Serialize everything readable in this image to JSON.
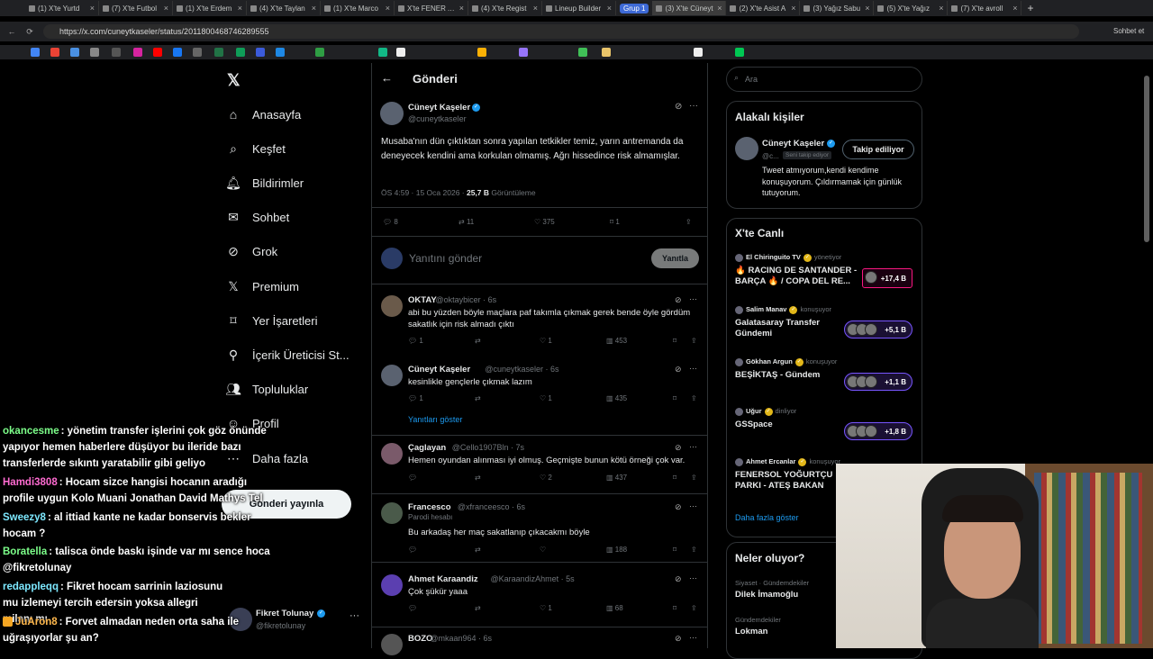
{
  "browser": {
    "tabs": [
      {
        "label": "(1) X'te Yurtd"
      },
      {
        "label": "(7) X'te Futbol"
      },
      {
        "label": "(1) X'te Erdem"
      },
      {
        "label": "(4) X'te Taylan"
      },
      {
        "label": "(1) X'te Marco"
      },
      {
        "label": "X'te FENER AĞ"
      },
      {
        "label": "(4) X'te Regist"
      },
      {
        "label": "Lineup Builder"
      },
      {
        "label": "(3) X'te Cüneyt"
      },
      {
        "label": "(2) X'te Asist A"
      },
      {
        "label": "(3) Yağız Sabu"
      },
      {
        "label": "(5) X'te Yağız"
      },
      {
        "label": "(7) X'te avroll"
      }
    ],
    "group_label": "Grup 1",
    "url": "https://x.com/cuneytkaseler/status/2011800468746289555",
    "chat_button": "Sohbet et"
  },
  "sidebar": {
    "items": [
      {
        "label": "Anasayfa",
        "icon": "home-icon"
      },
      {
        "label": "Keşfet",
        "icon": "search-icon"
      },
      {
        "label": "Bildirimler",
        "icon": "bell-icon"
      },
      {
        "label": "Sohbet",
        "icon": "mail-icon"
      },
      {
        "label": "Grok",
        "icon": "grok-icon"
      },
      {
        "label": "Premium",
        "icon": "x-icon"
      },
      {
        "label": "Yer İşaretleri",
        "icon": "bookmark-icon"
      },
      {
        "label": "İçerik Üreticisi St...",
        "icon": "creator-icon"
      },
      {
        "label": "Topluluklar",
        "icon": "people-icon"
      },
      {
        "label": "Profil",
        "icon": "user-icon"
      },
      {
        "label": "Daha fazla",
        "icon": "more-icon"
      }
    ],
    "post_button": "Gönderi yayınla",
    "account": {
      "name": "Fikret Tolunay",
      "handle": "@fikretolunay"
    }
  },
  "header": {
    "title": "Gönderi"
  },
  "main_post": {
    "name": "Cüneyt Kaşeler",
    "handle": "@cuneytkaseler",
    "text": "Musaba'nın dün çıktıktan sonra yapılan tetkikler temiz, yarın antremanda da deneyecek kendini ama korkulan olmamış. Ağrı hissedince risk almamışlar.",
    "time": "ÖS 4:59 · 15 Oca 2026 ·",
    "views": "25,7 B",
    "views_label": "Görüntüleme",
    "replies": "8",
    "reposts": "11",
    "likes": "375",
    "bookmarks": "1"
  },
  "reply_box": {
    "placeholder": "Yanıtını gönder",
    "button": "Yanıtla"
  },
  "replies": [
    {
      "name": "OKTAY",
      "handle": "@oktaybicer · 6s",
      "text": "abi bu yüzden böyle maçlara paf takımla çıkmak gerek bende öyle gördüm sakatlık için risk almadı çıktı",
      "reply": "1",
      "like": "1",
      "views": "453"
    },
    {
      "name": "Cüneyt Kaşeler",
      "handle": "@cuneytkaseler · 6s",
      "text": "kesinlikle gençlerle çıkmak lazım",
      "reply": "1",
      "like": "1",
      "views": "435"
    },
    {
      "name": "Çaglayan",
      "handle": "@Cello1907Bln · 7s",
      "text": "Hemen oyundan alınması iyi olmuş. Geçmişte bunun kötü örneği çok var.",
      "reply": "",
      "like": "2",
      "views": "437"
    },
    {
      "name": "Francesco",
      "handle": "@xfranceesco · 6s",
      "text": "Bu arkadaş her maç sakatlanıp çıkacakmı böyle",
      "reply": "",
      "like": "",
      "views": "188",
      "parody": "Parodi hesabı"
    },
    {
      "name": "Ahmet Karaandiz",
      "handle": "@KaraandizAhmet · 5s",
      "text": "Çok şükür yaaa",
      "reply": "",
      "like": "1",
      "views": "68"
    },
    {
      "name": "BOZO",
      "handle": "@mkaan964 · 6s"
    }
  ],
  "show_replies": "Yanıtları göster",
  "search": {
    "placeholder": "Ara"
  },
  "related": {
    "title": "Alakalı kişiler",
    "name": "Cüneyt Kaşeler",
    "handle": "@c...",
    "follows_you": "Seni takip ediyor",
    "button": "Takip ediliyor",
    "bio": "Tweet atmıyorum,kendi kendime konuşuyorum. Çıldırmamak için günlük tutuyorum."
  },
  "live": {
    "title": "X'te Canlı",
    "items": [
      {
        "host": "El Chiringuito TV",
        "role": "yönetiyor",
        "title": "🔥 RACING DE SANTANDER - BARÇA 🔥 / COPA DEL RE...",
        "count": "+17,4 B"
      },
      {
        "host": "Salim Manav",
        "role": "konuşuyor",
        "title": "Galatasaray Transfer Gündemi",
        "count": "+5,1 B"
      },
      {
        "host": "Gökhan Argun",
        "role": "konuşuyor",
        "title": "BEŞİKTAŞ - Gündem",
        "count": "+1,1 B"
      },
      {
        "host": "Uğur",
        "role": "dinliyor",
        "title": "GSSpace",
        "count": "+1,8 B"
      },
      {
        "host": "Ahmet Ercanlar",
        "role": "konuşuyor",
        "title": "FENERSOL YOĞURTÇU PARKI - ATEŞ BAKAN",
        "count": ""
      }
    ],
    "more": "Daha fazla göster"
  },
  "trends": {
    "title": "Neler oluyor?",
    "items": [
      {
        "context": "Siyaset · Gündemdekiler",
        "name": "Dilek İmamoğlu"
      },
      {
        "context": "Gündemdekiler",
        "name": "Lokman"
      }
    ]
  },
  "chat": [
    {
      "user": "okancesme",
      "color": "#7dff8a",
      "text": ": yönetim transfer işlerini çok göz önünde yapıyor hemen haberlere düşüyor bu ileride bazı transferlerde sıkıntı yaratabilir gibi geliyo"
    },
    {
      "user": "Hamdi3808",
      "color": "#ff6bd1",
      "text": ": Hocam sizce hangisi hocanın aradığı profile uygun Kolo Muani Jonathan David Mathys Tel"
    },
    {
      "user": "Sweezy8",
      "color": "#7de8ff",
      "text": ": al ittiad kante ne kadar bonservis bekler hocam ?"
    },
    {
      "user": "Boratella",
      "color": "#7dff8a",
      "text": ": talisca önde baskı işinde var mı sence hoca @fikretolunay"
    },
    {
      "user": "redappleqq",
      "color": "#7de8ff",
      "text": ": Fikret hocam sarrinin laziosunu mu izlemeyi tercih edersin yoksa allegri milanı mı"
    },
    {
      "user": "JuAron8",
      "color": "#ffb84d",
      "text": ": Forvet almadan neden orta saha ile uğraşıyorlar şu an?"
    }
  ]
}
